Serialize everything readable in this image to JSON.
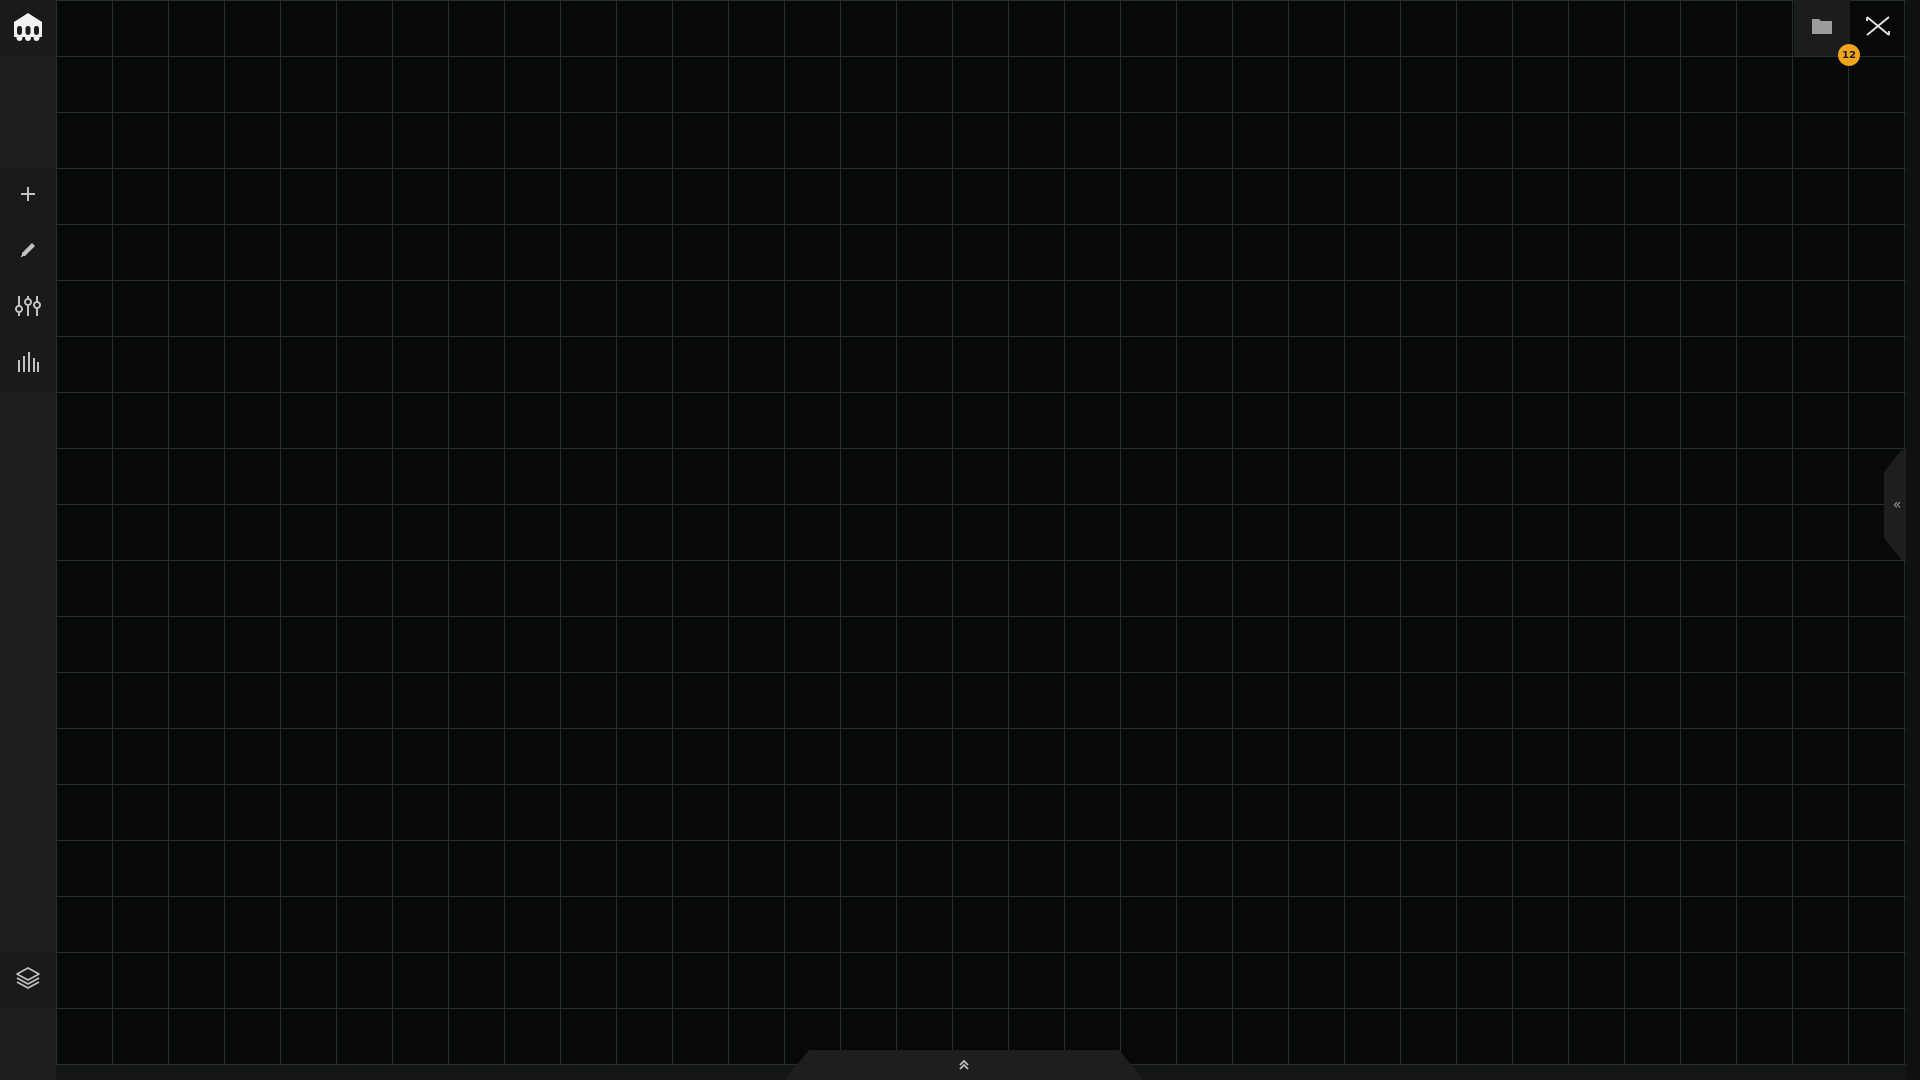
{
  "app": {
    "logo_icon": "robot-logo-icon"
  },
  "toolbar": {
    "tools": [
      {
        "name": "add",
        "icon": "plus-icon"
      },
      {
        "name": "edit",
        "icon": "pencil-icon"
      },
      {
        "name": "adjust",
        "icon": "sliders-icon"
      },
      {
        "name": "stats",
        "icon": "bar-chart-icon"
      }
    ],
    "layers_icon": "layers-icon"
  },
  "topbar": {
    "folder_icon": "folder-icon",
    "folder_badge_count": "12",
    "close_icon": "close-x-icon"
  },
  "panels": {
    "right_toggle_glyph": "«",
    "bottom_toggle_icon": "double-chevron-up-icon"
  },
  "colors": {
    "background": "#070909",
    "grid_line": "#2a2d2e",
    "sidebar": "#1e1f20",
    "badge": "#f0a51f",
    "icon": "#b8b8b8"
  }
}
